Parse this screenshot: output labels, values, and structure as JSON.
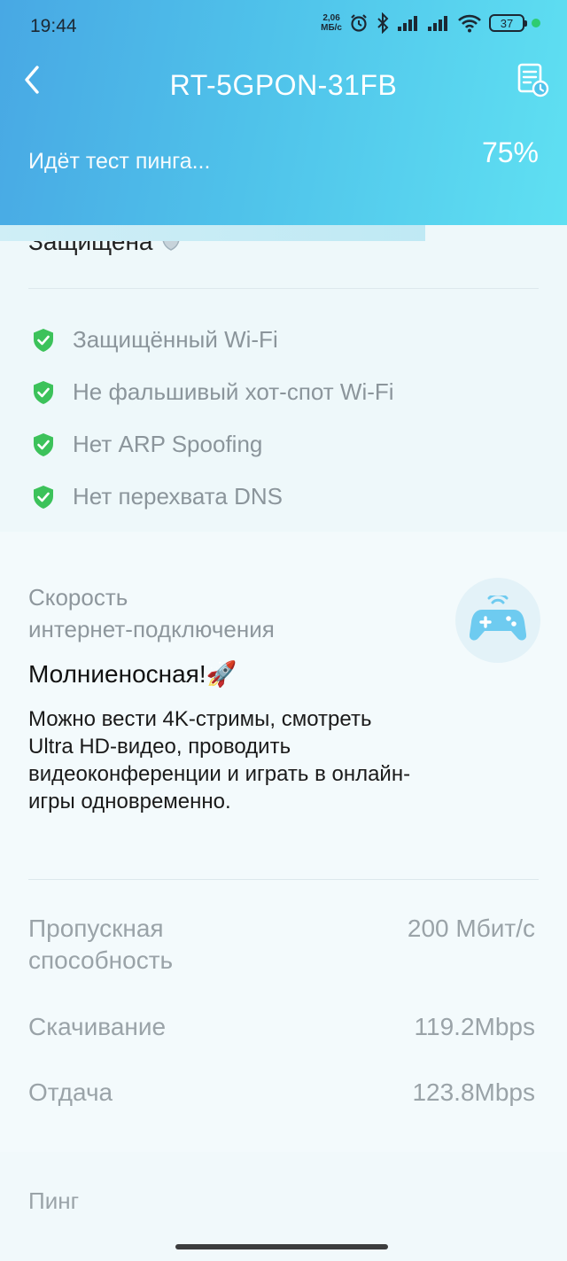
{
  "status_bar": {
    "time": "19:44",
    "net_speed_value": "2,06",
    "net_speed_unit": "МБ/с",
    "battery": "37"
  },
  "header": {
    "title": "RT-5GPON-31FB",
    "progress_label": "Идёт тест пинга...",
    "progress_value": "75%",
    "progress_fraction": 0.75
  },
  "security": {
    "title": "Защищена",
    "checks": [
      "Защищённый Wi-Fi",
      "Не фальшивый хот-спот Wi-Fi",
      "Нет ARP Spoofing",
      "Нет перехвата DNS"
    ]
  },
  "speed": {
    "heading_line1": "Скорость",
    "heading_line2": "интернет-подключения",
    "verdict": "Молниеносная!🚀",
    "description": "Можно вести 4K-стримы, смотреть Ultra HD-видео, проводить видеоконференции и играть в онлайн-игры одновременно.",
    "metrics": [
      {
        "label_line1": "Пропускная",
        "label_line2": "способность",
        "value": "200 Мбит/с"
      },
      {
        "label_line1": "Скачивание",
        "label_line2": "",
        "value": "119.2Mbps"
      },
      {
        "label_line1": "Отдача",
        "label_line2": "",
        "value": "123.8Mbps"
      }
    ],
    "ping_label": "Пинг"
  },
  "colors": {
    "header_start": "#48a8e4",
    "header_end": "#5fe0f2",
    "check_green": "#3cc25a",
    "gamepad_blue": "#6ecbf0"
  }
}
